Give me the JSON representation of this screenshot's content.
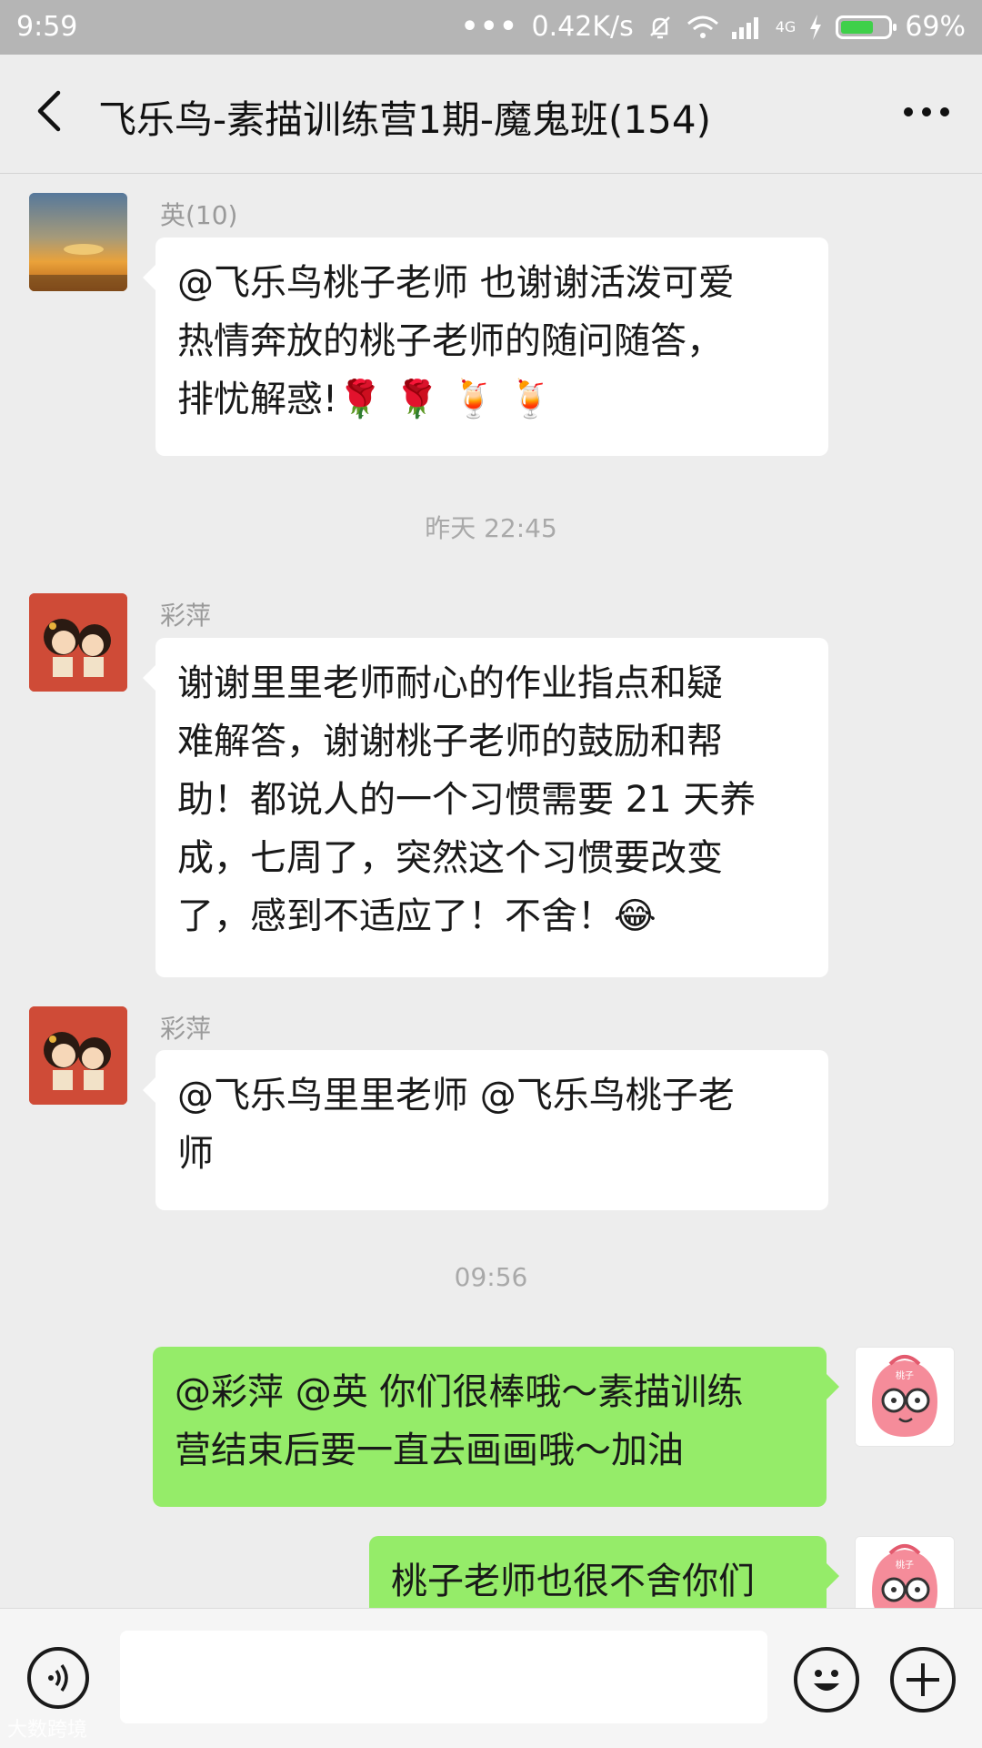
{
  "status_bar": {
    "time": "9:59",
    "network_speed": "0.42K/s",
    "network_type": "4G",
    "battery_percent": "69%",
    "battery_level": 0.69
  },
  "header": {
    "title": "飞乐鸟-素描训练营1期-魔鬼班(154)"
  },
  "messages": [
    {
      "sender": "英(10)",
      "text_lines": [
        "@飞乐鸟桃子老师  也谢谢活泼可爱",
        "热情奔放的桃子老师的随问随答，",
        "排忧解惑!🌹 🌹 🍹 🍹"
      ]
    },
    {
      "timestamp": "昨天 22:45"
    },
    {
      "sender": "彩萍",
      "text_lines": [
        "谢谢里里老师耐心的作业指点和疑",
        "难解答，谢谢桃子老师的鼓励和帮",
        "助！都说人的一个习惯需要 21 天养",
        "成，七周了，突然这个习惯要改变",
        "了，感到不适应了！不舍！😂"
      ]
    },
    {
      "sender": "彩萍",
      "text_lines": [
        "@飞乐鸟里里老师 @飞乐鸟桃子老",
        "师"
      ]
    },
    {
      "timestamp": "09:56"
    },
    {
      "mine": true,
      "text_lines": [
        "@彩萍 @英 你们很棒哦～素描训练",
        "营结束后要一直去画画哦～加油"
      ]
    },
    {
      "mine": true,
      "text_lines": [
        "桃子老师也很不舍你们"
      ]
    }
  ],
  "avatar_labels": {
    "peach": "桃子"
  },
  "input_bar": {
    "placeholder": ""
  },
  "watermark": "大数跨境",
  "colors": {
    "my_bubble": "#95ec69",
    "background": "#ededed",
    "battery": "#3fd04a"
  }
}
